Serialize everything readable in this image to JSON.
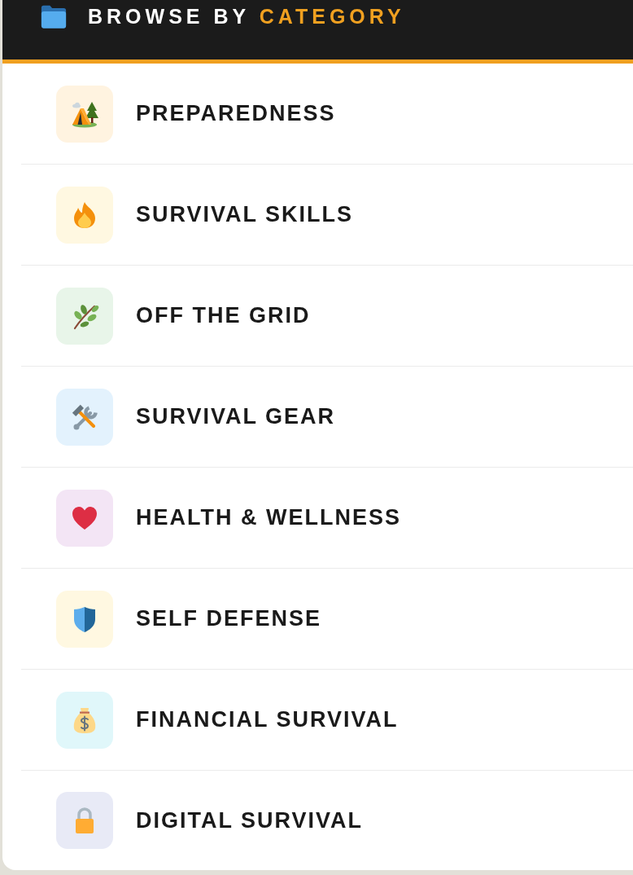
{
  "header": {
    "title": "BROWSE BY",
    "title_accent": "CATEGORY"
  },
  "categories": [
    {
      "label": "PREPAREDNESS",
      "kind": "tent",
      "color": "#fff3e0"
    },
    {
      "label": "SURVIVAL SKILLS",
      "kind": "fire",
      "color": "#fff8e1"
    },
    {
      "label": "OFF THE GRID",
      "kind": "herb",
      "color": "#e8f5e9"
    },
    {
      "label": "SURVIVAL GEAR",
      "kind": "tools",
      "color": "#e3f2fd"
    },
    {
      "label": "HEALTH & WELLNESS",
      "kind": "heart",
      "color": "#f3e5f5"
    },
    {
      "label": "SELF DEFENSE",
      "kind": "shield",
      "color": "#fff8e1"
    },
    {
      "label": "FINANCIAL SURVIVAL",
      "kind": "moneybag",
      "color": "#e0f7fa"
    },
    {
      "label": "DIGITAL SURVIVAL",
      "kind": "lock",
      "color": "#e8eaf6"
    }
  ]
}
